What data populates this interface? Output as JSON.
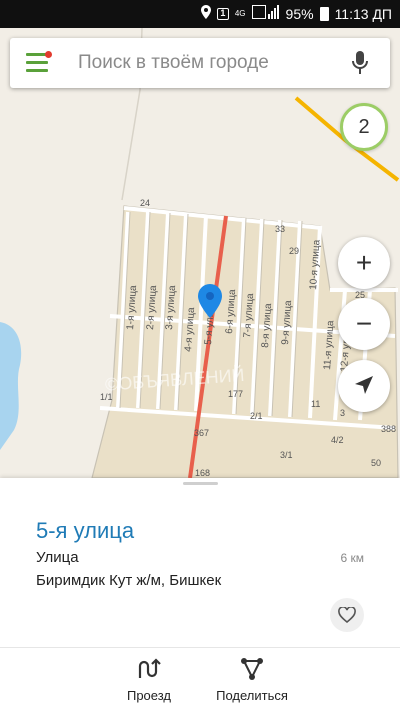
{
  "status_bar": {
    "sim_badge": "1",
    "network": "4G",
    "battery": "95%",
    "time": "11:13 ДП"
  },
  "search": {
    "placeholder": "Поиск в твоём городе"
  },
  "map": {
    "layer_count": "2",
    "street_labels": [
      "1-я улица",
      "2-я улица",
      "3-я улица",
      "4-я улица",
      "5-я улица",
      "6-я улица",
      "7-я улица",
      "8-я улица",
      "9-я улица",
      "10-я улица",
      "11-я улица",
      "12-я улица"
    ],
    "house_numbers": [
      "24",
      "33",
      "29",
      "25",
      "177",
      "1/1",
      "367",
      "2/1",
      "11",
      "3",
      "388",
      "4/2",
      "3/1",
      "50",
      "168"
    ],
    "watermark": "©ОБЪЯВЛЕНИЙ",
    "zoom_in": "+",
    "zoom_out": "−"
  },
  "place": {
    "title": "5-я улица",
    "type": "Улица",
    "address": "Биримдик Кут ж/м, Бишкек",
    "distance": "6 км"
  },
  "actions": {
    "route_label": "Проезд",
    "share_label": "Поделиться"
  },
  "colors": {
    "accent_green": "#5aa13a",
    "title_blue": "#1f7bb6",
    "route_red": "#e8604c",
    "pin_blue": "#1e88e5",
    "badge_ring": "#9ccd66"
  }
}
